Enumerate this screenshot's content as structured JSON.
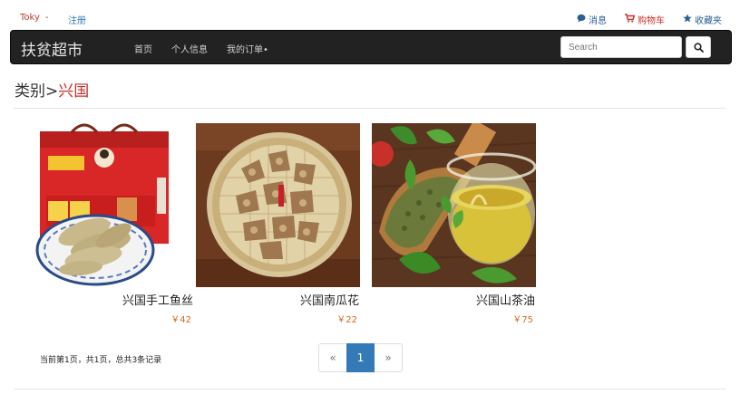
{
  "topbar": {
    "username": "Toky",
    "user_caret": "-",
    "register": "注册",
    "messages": "消息",
    "cart": "购物车",
    "favorites": "收藏夹"
  },
  "navbar": {
    "brand": "扶贫超市",
    "items": [
      "首页",
      "个人信息",
      "我的订单"
    ],
    "orders_caret": "•",
    "search_placeholder": "Search"
  },
  "heading": {
    "prefix": "类别>",
    "category": "兴国"
  },
  "products": [
    {
      "name": "兴国手工鱼丝",
      "price": "￥42"
    },
    {
      "name": "兴国南瓜花",
      "price": "￥22"
    },
    {
      "name": "兴国山茶油",
      "price": "￥75"
    }
  ],
  "pagination": {
    "info": "当前第1页，共1页，总共3条记录",
    "prev": "«",
    "current": "1",
    "next": "»"
  },
  "colors": {
    "navbar_bg": "#222222",
    "accent": "#337ab7",
    "price": "#d2691e",
    "category": "#c9302c"
  }
}
